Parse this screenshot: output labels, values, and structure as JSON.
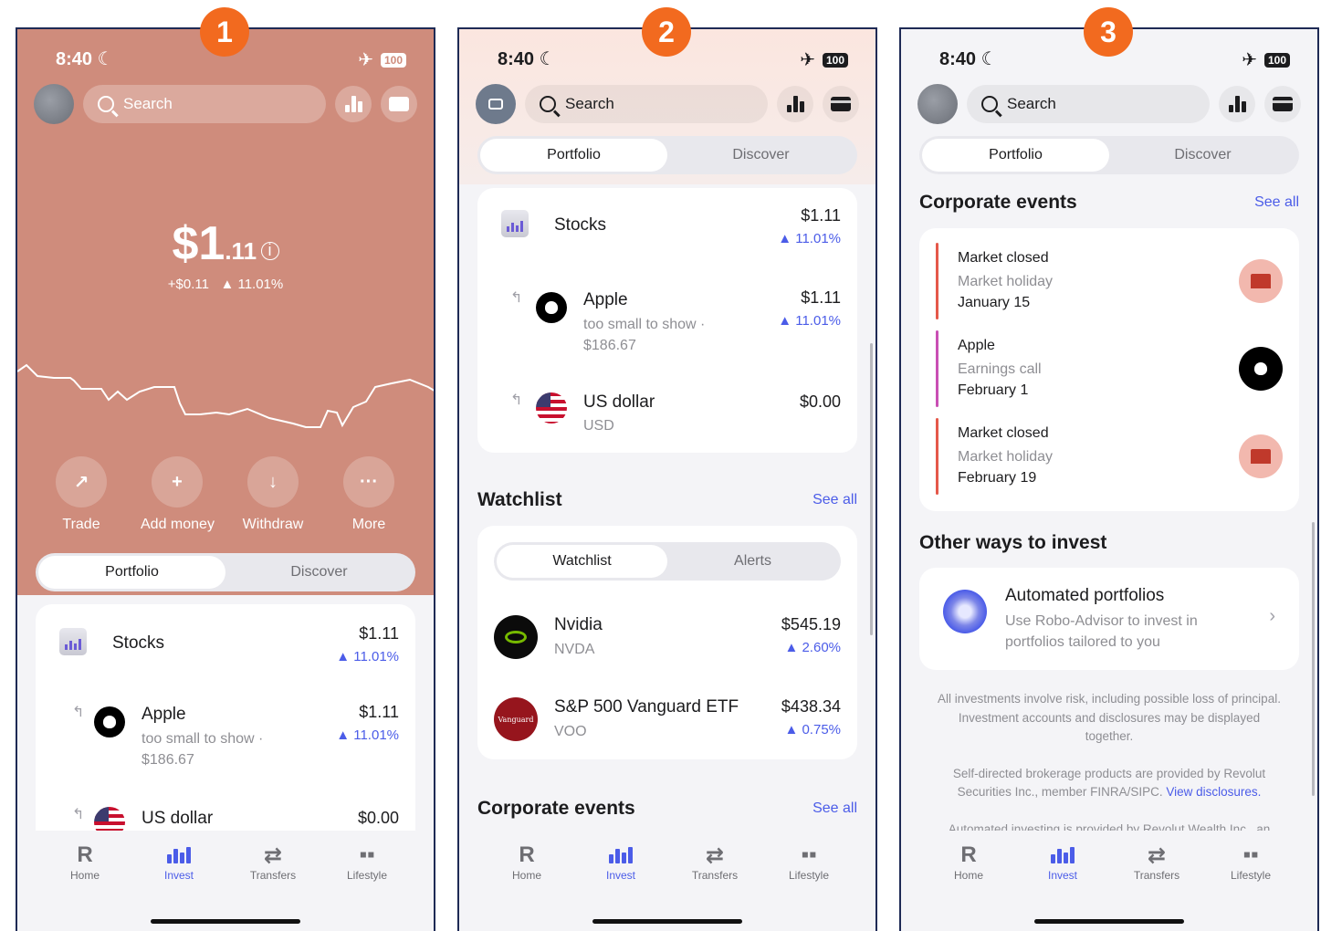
{
  "badges": [
    "1",
    "2",
    "3"
  ],
  "status": {
    "time": "8:40",
    "battery": "100"
  },
  "search": {
    "placeholder": "Search"
  },
  "segments": {
    "portfolio": "Portfolio",
    "discover": "Discover"
  },
  "screen1": {
    "balance_main": "$1",
    "balance_cents": ".11",
    "change_amount": "+$0.11",
    "change_pct": "▲ 11.01%",
    "actions": [
      {
        "label": "Trade",
        "icon": "trend-up-icon"
      },
      {
        "label": "Add money",
        "icon": "plus-icon"
      },
      {
        "label": "Withdraw",
        "icon": "arrow-down-icon"
      },
      {
        "label": "More",
        "icon": "ellipsis-icon"
      }
    ]
  },
  "holdings": {
    "stocks": {
      "label": "Stocks",
      "value": "$1.11",
      "pct": "▲ 11.01%"
    },
    "apple": {
      "label": "Apple",
      "sub1": "too small to show ·",
      "sub2": "$186.67",
      "value": "$1.11",
      "pct": "▲ 11.01%"
    },
    "usd": {
      "label": "US dollar",
      "sub": "USD",
      "value": "$0.00"
    }
  },
  "watchlist": {
    "title": "Watchlist",
    "see_all": "See all",
    "tabs": {
      "watchlist": "Watchlist",
      "alerts": "Alerts"
    },
    "items": [
      {
        "name": "Nvidia",
        "ticker": "NVDA",
        "price": "$545.19",
        "pct": "▲ 2.60%"
      },
      {
        "name": "S&P 500 Vanguard ETF",
        "ticker": "VOO",
        "price": "$438.34",
        "pct": "▲ 0.75%",
        "logo_text": "Vanguard"
      }
    ]
  },
  "corporate": {
    "title": "Corporate events",
    "see_all": "See all",
    "events": [
      {
        "title": "Market closed",
        "type": "Market holiday",
        "date": "January 15",
        "color": "#e5584a"
      },
      {
        "title": "Apple",
        "type": "Earnings call",
        "date": "February 1",
        "color": "#c94fb4"
      },
      {
        "title": "Market closed",
        "type": "Market holiday",
        "date": "February 19",
        "color": "#e5584a"
      }
    ]
  },
  "other": {
    "title": "Other ways to invest",
    "item_title": "Automated portfolios",
    "item_desc1": "Use Robo-Advisor to invest in",
    "item_desc2": "portfolios tailored to you"
  },
  "disclaimer": {
    "p1_l1": "All investments involve risk, including possible loss of principal.",
    "p1_l2": "Investment accounts and disclosures may be displayed",
    "p1_l3": "together.",
    "p2_l1": "Self-directed brokerage products are provided by Revolut",
    "p2_l2": "Securities Inc., member FINRA/SIPC.",
    "p2_link": "View disclosures.",
    "p3_l1": "Automated investing is provided by Revolut Wealth Inc., an"
  },
  "tabbar": [
    {
      "label": "Home",
      "icon": "R"
    },
    {
      "label": "Invest",
      "icon": "invest-icon"
    },
    {
      "label": "Transfers",
      "icon": "transfers-icon"
    },
    {
      "label": "Lifestyle",
      "icon": "lifestyle-icon"
    }
  ],
  "colors": {
    "hero": "#cf8c7c",
    "accent": "#4b5ce8",
    "badge": "#f26a1f"
  }
}
